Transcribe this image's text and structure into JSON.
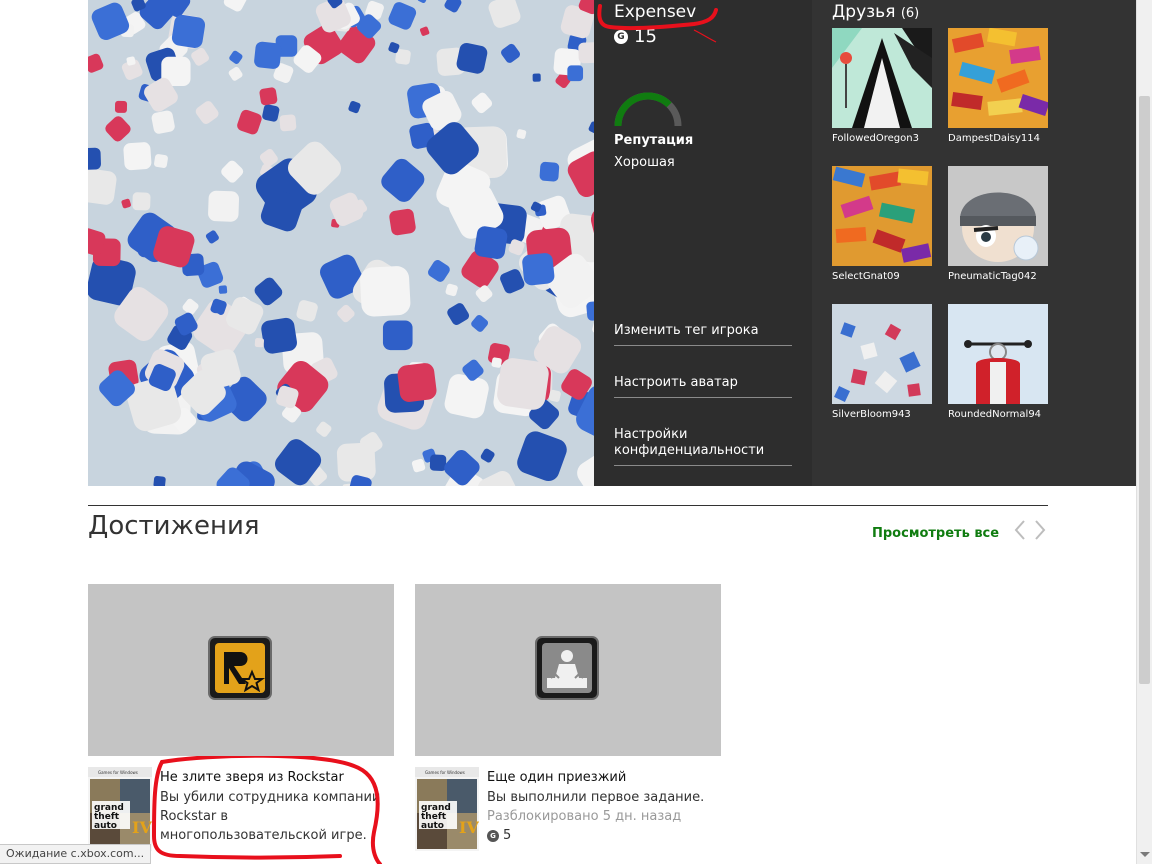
{
  "profile": {
    "gamertag": "Expensev",
    "gamerscore": "15",
    "gamerscore_badge": "G",
    "reputation_label": "Репутация",
    "reputation_value": "Хорошая",
    "reputation_level": 0.75,
    "reputation_color": "#107c10",
    "menu": [
      {
        "label": "Изменить тег игрока"
      },
      {
        "label": "Настроить аватар"
      },
      {
        "label": "Настройки конфиденциальности"
      }
    ]
  },
  "friends": {
    "title": "Друзья",
    "count": "(6)",
    "list": [
      {
        "name": "FollowedOregon3"
      },
      {
        "name": "DampestDaisy114"
      },
      {
        "name": "SelectGnat09"
      },
      {
        "name": "PneumaticTag042"
      },
      {
        "name": "SilverBloom943"
      },
      {
        "name": "RoundedNormal94"
      }
    ]
  },
  "achievements": {
    "heading": "Достижения",
    "view_all": "Просмотреть все",
    "accent_color": "#107c10",
    "items": [
      {
        "icon": "rockstar-icon",
        "title": "Не злите зверя из Rockstar",
        "description": "Вы убили сотрудника компании Rockstar в многопользовательской игре.",
        "unlocked": "",
        "score": ""
      },
      {
        "icon": "achievement-person-icon",
        "title": "Еще один приезжий",
        "description": "Вы выполнили первое задание.",
        "unlocked": "Разблокировано 5 дн. назад",
        "score": "5",
        "score_badge": "G"
      }
    ],
    "box_art_label": "Games for Windows"
  },
  "status_bar": {
    "text": "Ожидание c.xbox.com..."
  }
}
